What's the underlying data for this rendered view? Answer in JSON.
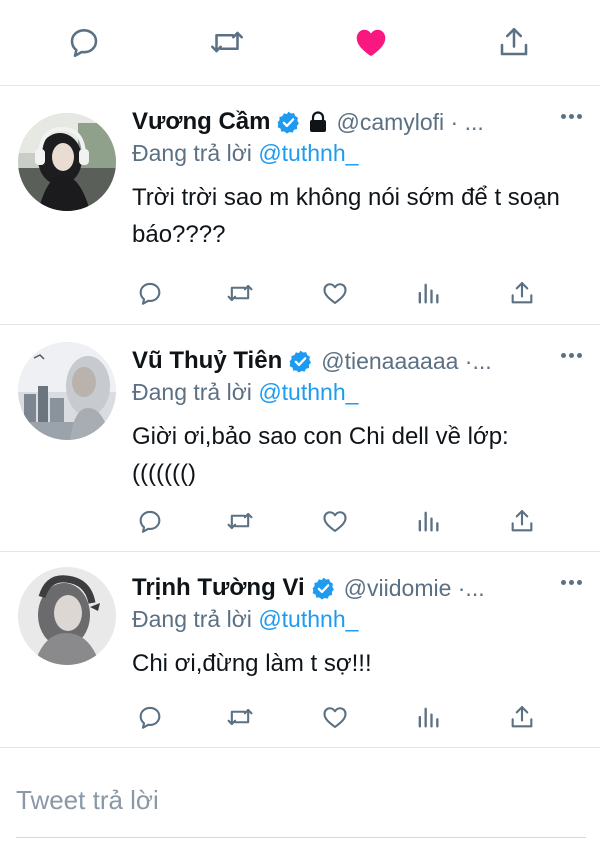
{
  "top_actions": {
    "liked": true,
    "like_color": "#f91880",
    "icon_color": "#5b7083",
    "icons": [
      "reply-icon",
      "retweet-icon",
      "heart-filled-icon",
      "share-icon"
    ]
  },
  "replies": [
    {
      "name": "Vương Cầm",
      "verified": true,
      "protected": true,
      "handle": "@camylofi · ...",
      "replying_prefix": "Đang trả lời ",
      "replying_to": "@tuthnh_",
      "text": "Trời trời sao m không nói sớm để t soạn báo????"
    },
    {
      "name": "Vũ Thuỷ Tiên",
      "verified": true,
      "protected": false,
      "handle": "@tienaaaaaa ·...",
      "replying_prefix": "Đang trả lời ",
      "replying_to": "@tuthnh_",
      "text": "Giời ơi,bảo sao con Chi dell về lớp: ((((((()"
    },
    {
      "name": "Trịnh Tường Vi",
      "verified": true,
      "protected": false,
      "handle": "@viidomie ·...",
      "replying_prefix": "Đang trả lời ",
      "replying_to": "@tuthnh_",
      "text": "Chi ơi,đừng làm t sợ!!!"
    }
  ],
  "compose": {
    "placeholder": "Tweet trả lời"
  },
  "colors": {
    "accent": "#1d9bf0",
    "secondary_text": "#5b7083",
    "divider": "#e1e6ea"
  }
}
